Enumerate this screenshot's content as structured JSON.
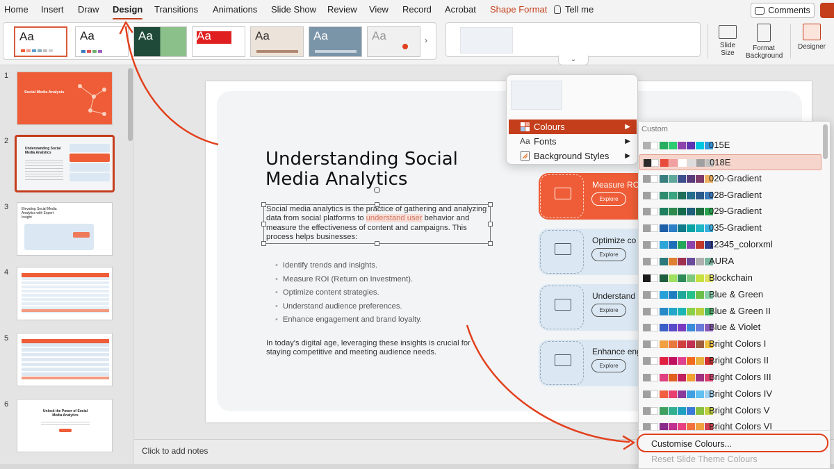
{
  "ribbon_tabs": [
    "Home",
    "Insert",
    "Draw",
    "Design",
    "Transitions",
    "Animations",
    "Slide Show",
    "Review",
    "View",
    "Record",
    "Acrobat",
    "Shape Format"
  ],
  "active_tab": "Design",
  "tell_me": "Tell me",
  "comments_label": "Comments",
  "theme_thumb_label": "Aa",
  "ribbon_buttons": {
    "slide_size": "Slide Size",
    "format_background": "Format Background",
    "designer": "Designer"
  },
  "slide_numbers": [
    "1",
    "2",
    "3",
    "4",
    "5",
    "6"
  ],
  "thumbnails": {
    "t1_title": "Social Media Analysis",
    "t2_title": "Understanding Social Media Analytics",
    "t3_title": "Elevating Social Media Analytics with Expert Insight",
    "t6_title": "Unlock the Power of Social Media Analytics"
  },
  "slide": {
    "title": "Understanding Social Media Analytics",
    "para_before": "Social media analytics is the practice of gathering and analyzing data from social platforms to ",
    "para_highlight": "understand user",
    "para_after": " behavior and measure the effectiveness of content and campaigns. This process helps businesses:",
    "bullets": [
      "Identify trends and insights.",
      "Measure ROI (Return on Investment).",
      "Optimize content strategies.",
      "Understand audience preferences.",
      "Enhance engagement and brand loyalty."
    ],
    "closing": "In today's digital age, leveraging these insights is crucial for staying competitive and meeting audience needs.",
    "cards": [
      {
        "title": "Measure RO",
        "button": "Explore"
      },
      {
        "title": "Optimize co",
        "button": "Explore"
      },
      {
        "title": "Understand",
        "button": "Explore"
      },
      {
        "title": "Enhance eng",
        "button": "Explore"
      }
    ]
  },
  "notes_placeholder": "Click to add notes",
  "variants_menu": {
    "items": [
      "Colours",
      "Fonts",
      "Background Styles"
    ],
    "fonts_icon_text": "Aa"
  },
  "colours_menu": {
    "header": "Custom",
    "schemes": [
      {
        "name": "015E",
        "colors": [
          "#b0b0b0",
          "#ffffff",
          "#27ae60",
          "#2ecc71",
          "#8e44ad",
          "#5e35b1",
          "#00c8e0",
          "#3498db"
        ]
      },
      {
        "name": "018E",
        "colors": [
          "#2b2b2b",
          "#ffffff",
          "#e74c3c",
          "#f0a0a0",
          "#ffffff",
          "#dddddd",
          "#a0a0a0",
          "#c0c0c0"
        ]
      },
      {
        "name": "020-Gradient",
        "colors": [
          "#a0a0a0",
          "#ffffff",
          "#3a7f7f",
          "#5fa89a",
          "#3d4e8c",
          "#5a3b7a",
          "#7d3a6a",
          "#f0b060"
        ]
      },
      {
        "name": "028-Gradient",
        "colors": [
          "#a0a0a0",
          "#ffffff",
          "#2e8b6e",
          "#3aa37f",
          "#1e6e5a",
          "#246c8c",
          "#2a5a8a",
          "#3c7ab8"
        ]
      },
      {
        "name": "029-Gradient",
        "colors": [
          "#a0a0a0",
          "#ffffff",
          "#1e7e5e",
          "#2f8a4e",
          "#136b4b",
          "#1e5f7a",
          "#1f6e3f",
          "#27a34f"
        ]
      },
      {
        "name": "035-Gradient",
        "colors": [
          "#a0a0a0",
          "#ffffff",
          "#1f5fa8",
          "#2d7fc7",
          "#0e7a8a",
          "#0aa3a3",
          "#1fb5c5",
          "#3ab0e0"
        ]
      },
      {
        "name": "12345_colorxml",
        "colors": [
          "#a0a0a0",
          "#ffffff",
          "#2aa5d8",
          "#1e6fb8",
          "#26a65b",
          "#8e44ad",
          "#c0392b",
          "#2c3e90"
        ]
      },
      {
        "name": "AURA",
        "colors": [
          "#a0a0a0",
          "#ffffff",
          "#2c7a7b",
          "#e08030",
          "#a03050",
          "#6a4a9a",
          "#b0b0b0",
          "#7ab8a0"
        ]
      },
      {
        "name": "Blockchain",
        "colors": [
          "#1a1a1a",
          "#ffffff",
          "#1e5f3f",
          "#a0e060",
          "#2e8b57",
          "#7fc97f",
          "#c8e040",
          "#e0e060"
        ]
      },
      {
        "name": "Blue & Green",
        "colors": [
          "#a0a0a0",
          "#ffffff",
          "#2aa0d8",
          "#1e7ec0",
          "#1fa89a",
          "#26c08a",
          "#6cc04a",
          "#88d0a8"
        ]
      },
      {
        "name": "Blue & Green II",
        "colors": [
          "#a0a0a0",
          "#ffffff",
          "#2a8ac8",
          "#23a7c8",
          "#1cb5b5",
          "#8ad04a",
          "#b8d040",
          "#4ab86a"
        ]
      },
      {
        "name": "Blue & Violet",
        "colors": [
          "#a0a0a0",
          "#ffffff",
          "#3a5fc8",
          "#5a4ac8",
          "#7a3ac0",
          "#3a8ad8",
          "#6a7ad8",
          "#8a5ab8"
        ]
      },
      {
        "name": "Bright Colors I",
        "colors": [
          "#a0a0a0",
          "#ffffff",
          "#f0a040",
          "#e87840",
          "#d04040",
          "#c03050",
          "#a06040",
          "#f0c040"
        ]
      },
      {
        "name": "Bright Colors II",
        "colors": [
          "#a0a0a0",
          "#ffffff",
          "#e02040",
          "#c01060",
          "#e04090",
          "#f06a20",
          "#e8b040",
          "#d03030"
        ]
      },
      {
        "name": "Bright Colors III",
        "colors": [
          "#a0a0a0",
          "#ffffff",
          "#e04080",
          "#e06020",
          "#c02060",
          "#f0a030",
          "#a03080",
          "#d84070"
        ]
      },
      {
        "name": "Bright Colors IV",
        "colors": [
          "#a0a0a0",
          "#ffffff",
          "#f06040",
          "#e84070",
          "#8a3a9a",
          "#40a0e0",
          "#60c0f0",
          "#a0d0f0"
        ]
      },
      {
        "name": "Bright Colors V",
        "colors": [
          "#a0a0a0",
          "#ffffff",
          "#40a060",
          "#30b090",
          "#20a0c0",
          "#3a7ad8",
          "#8ac040",
          "#c0d040"
        ]
      },
      {
        "name": "Bright Colors VI",
        "colors": [
          "#a0a0a0",
          "#ffffff",
          "#8a2a8a",
          "#c03090",
          "#e84080",
          "#f07040",
          "#f0a040",
          "#d04050"
        ]
      }
    ],
    "customise": "Customise Colours...",
    "reset": "Reset Slide Theme Colours"
  },
  "colors": {
    "accent": "#c43e1c",
    "annotation": "#e2401c",
    "card_orange": "#ee5d37",
    "card_blue": "#dbe8f3"
  },
  "icons": [
    "lightbulb-icon",
    "comment-icon",
    "slide-size-icon",
    "format-background-icon",
    "designer-icon",
    "colour-grid-icon",
    "font-icon",
    "background-styles-icon",
    "chevron-down-icon",
    "chevron-right-icon"
  ]
}
